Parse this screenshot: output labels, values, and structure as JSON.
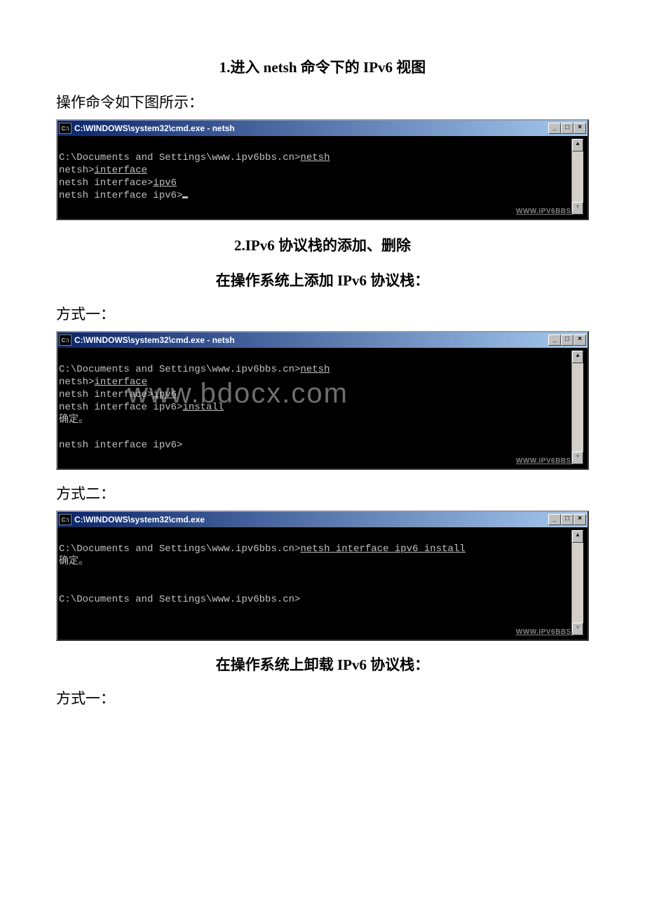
{
  "section1": {
    "heading": "1.进入 netsh 命令下的 IPv6 视图",
    "intro": "操作命令如下图所示："
  },
  "term1": {
    "title": "C:\\WINDOWS\\system32\\cmd.exe - netsh",
    "line1_prefix": "C:\\Documents and Settings\\www.ipv6bbs.cn>",
    "line1_cmd": "netsh",
    "line2_prefix": "netsh>",
    "line2_cmd": "interface",
    "line3_prefix": "netsh interface>",
    "line3_cmd": "ipv6",
    "line4_prompt": "netsh interface ipv6>",
    "footer": "WWW.IPV6BBS."
  },
  "section2": {
    "heading": "2.IPv6 协议栈的添加、删除",
    "sub_add": "在操作系统上添加 IPv6 协议栈：",
    "method1": "方式一：",
    "method2": "方式二："
  },
  "term2": {
    "title": "C:\\WINDOWS\\system32\\cmd.exe - netsh",
    "line1_prefix": "C:\\Documents and Settings\\www.ipv6bbs.cn>",
    "line1_cmd": "netsh",
    "line2_prefix": "netsh>",
    "line2_cmd": "interface",
    "line3_prefix": "netsh interface>",
    "line3_cmd": "ipv6",
    "line4_prefix": "netsh interface ipv6>",
    "line4_cmd": "install",
    "line5": "确定。",
    "line6_prompt": "netsh interface ipv6>",
    "watermark": "www.bdocx.com",
    "footer": "WWW.IPV6BBS."
  },
  "term3": {
    "title": "C:\\WINDOWS\\system32\\cmd.exe",
    "line1_prefix": "C:\\Documents and Settings\\www.ipv6bbs.cn>",
    "line1_cmd": "netsh interface ipv6 install",
    "line2": "确定。",
    "line3_prompt": "C:\\Documents and Settings\\www.ipv6bbs.cn>",
    "footer": "WWW.IPV6BBS."
  },
  "section3": {
    "sub_remove": "在操作系统上卸载 IPv6 协议栈：",
    "method1": "方式一："
  },
  "icon_label": "C:\\"
}
